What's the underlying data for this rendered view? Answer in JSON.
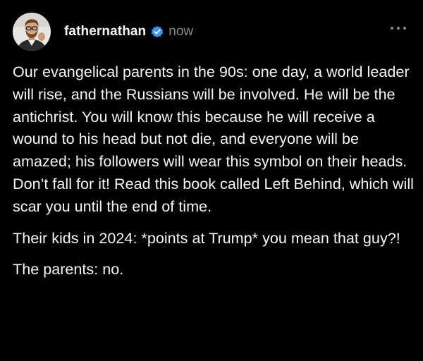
{
  "post": {
    "author": {
      "username": "fathernathan",
      "avatar_icon": "avatar-photo",
      "verified_icon": "verified-badge-icon",
      "verified_color": "#3897f0"
    },
    "timestamp": "now",
    "more_icon": "more-options-icon",
    "paragraphs": [
      "Our evangelical parents in the 90s: one day, a world leader will rise, and the Russians will be involved. He will be the antichrist. You will know this because he will receive a wound to his head but not die, and everyone will be amazed; his followers will wear this symbol on their heads. Don’t fall for it! Read this book called Left Behind, which will scar you until the end of time.",
      "Their kids in 2024: *points at Trump* you mean that guy?!",
      "The parents: no."
    ]
  },
  "colors": {
    "background": "#000000",
    "text": "#f3f5f7",
    "muted": "#8a8a8a"
  }
}
